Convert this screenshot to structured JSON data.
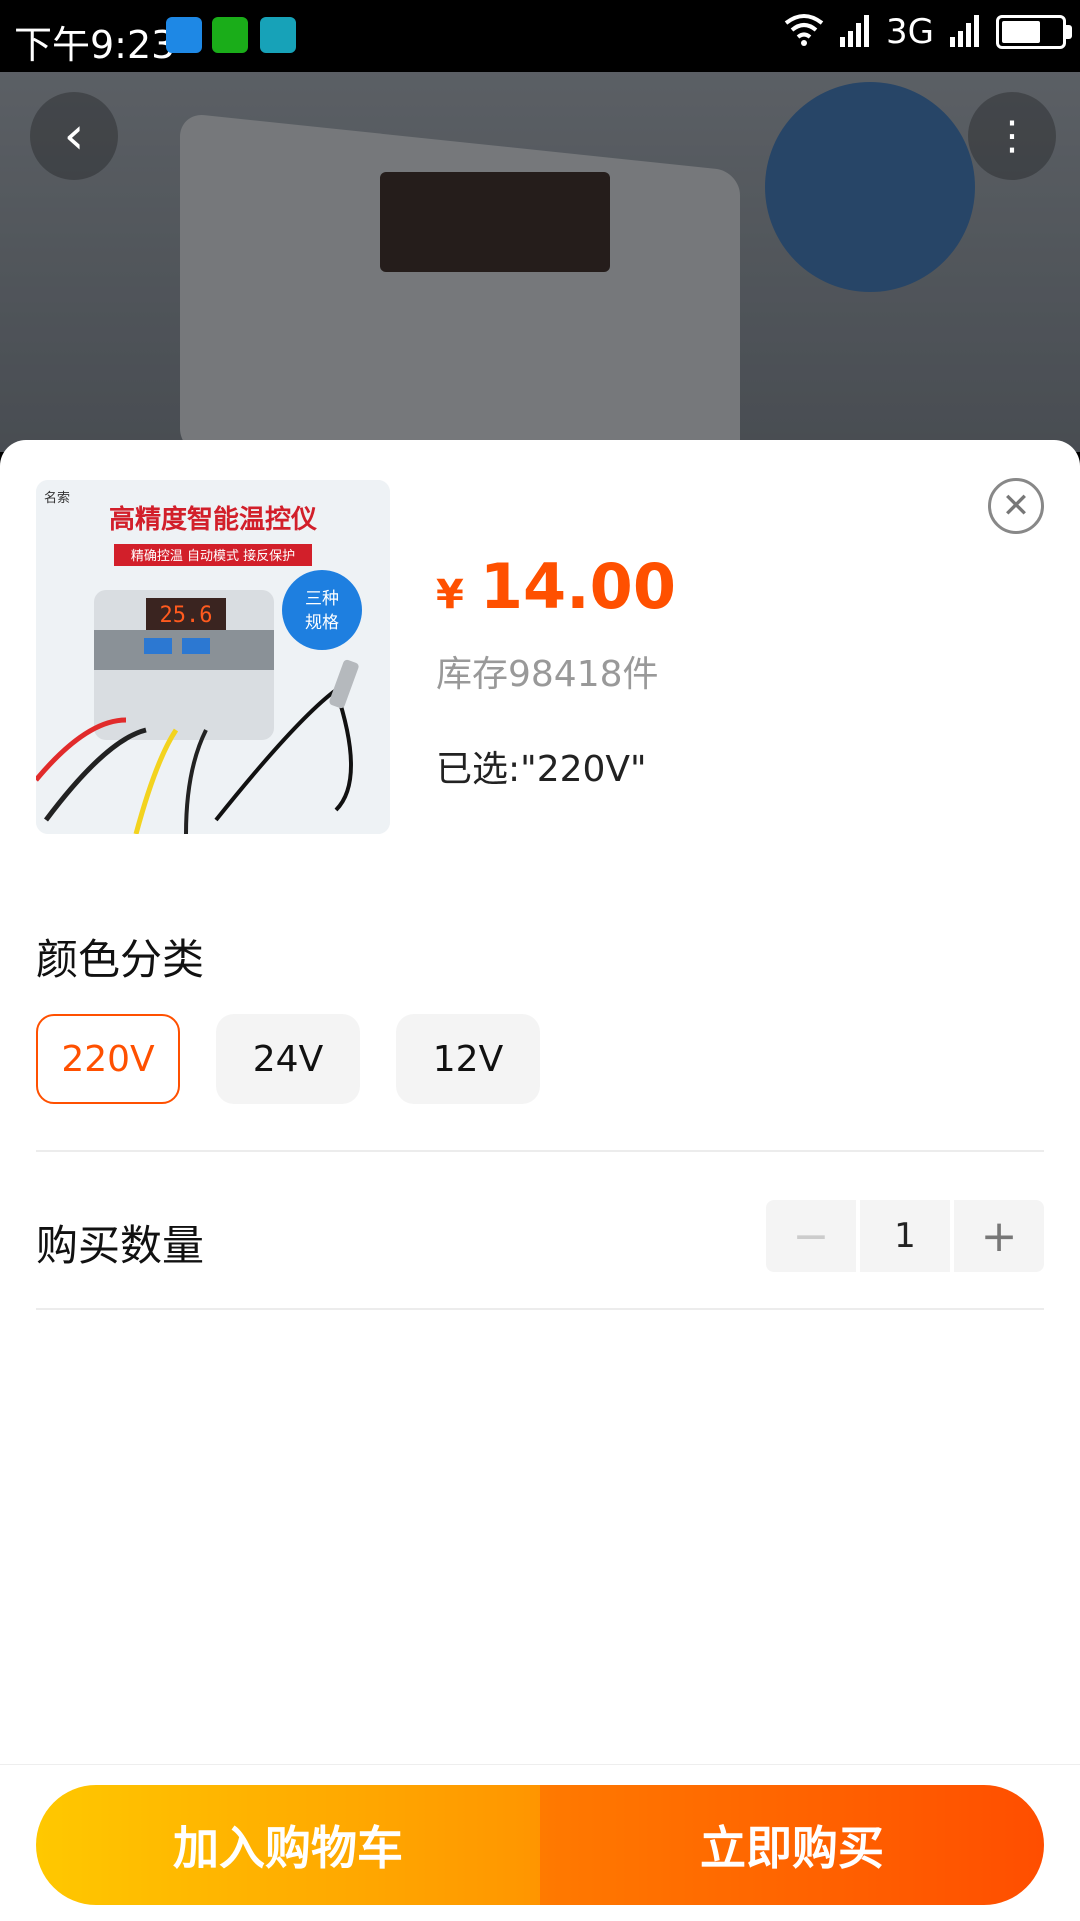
{
  "status_bar": {
    "time": "下午9:23",
    "network": "3G"
  },
  "product_sheet": {
    "currency": "¥",
    "price": "14.00",
    "stock_text": "库存98418件",
    "selected_text": "已选:\"220V\"",
    "sku_section_title": "颜色分类",
    "sku_options": [
      "220V",
      "24V",
      "12V"
    ],
    "quantity_label": "购买数量",
    "quantity_value": "1",
    "add_to_cart": "加入购物车",
    "buy_now": "立即购买",
    "thumb": {
      "brand": "名索",
      "title": "高精度智能温控仪",
      "tagline": "精确控温   自动模式   接反保护",
      "display": "25.6",
      "badge": "三种规格"
    }
  },
  "icons": {
    "close": "close-icon",
    "back": "back-icon",
    "more": "more-icon"
  },
  "colors": {
    "accent": "#ff5000",
    "cart_start": "#ffc800",
    "cart_end": "#ff9500",
    "buy_start": "#ff7a00",
    "buy_end": "#ff4e00"
  }
}
